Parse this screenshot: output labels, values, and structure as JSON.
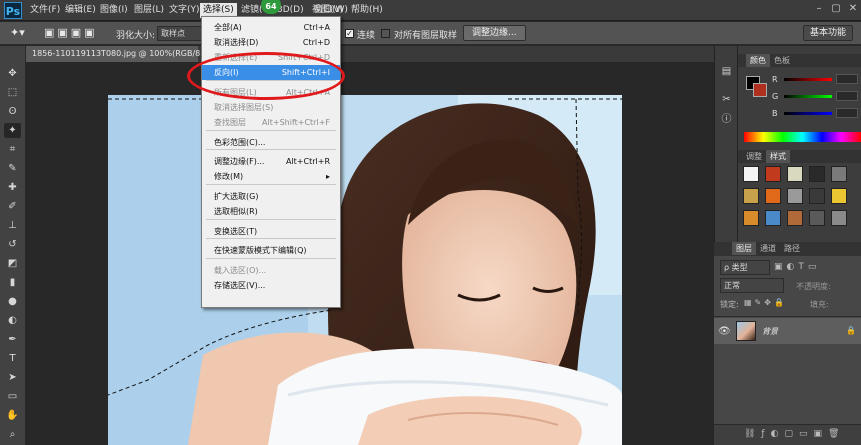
{
  "menubar": {
    "items": [
      "文件(F)",
      "编辑(E)",
      "图像(I)",
      "图层(L)",
      "文字(Y)",
      "选择(S)",
      "滤镜(T)",
      "3D(D)",
      "视图(V)",
      "窗口(W)",
      "帮助(H)"
    ],
    "badge": "64"
  },
  "options": {
    "feather_label": "羽化大小:",
    "feather_value": "取样点",
    "contiguous": "连续",
    "sample_all": "对所有图层取样",
    "refine_button": "调整边缘...",
    "workspace": "基本功能"
  },
  "document": {
    "tab_title": "1856-110119113T080.jpg @ 100%(RGB/8#)"
  },
  "select_menu": {
    "items": [
      {
        "label": "全部(A)",
        "shortcut": "Ctrl+A",
        "state": "normal"
      },
      {
        "label": "取消选择(D)",
        "shortcut": "Ctrl+D",
        "state": "normal"
      },
      {
        "label": "重新选择(E)",
        "shortcut": "Shift+Ctrl+D",
        "state": "disabled"
      },
      {
        "label": "反向(I)",
        "shortcut": "Shift+Ctrl+I",
        "state": "highlighted"
      },
      {
        "label": "所有图层(L)",
        "shortcut": "Alt+Ctrl+A",
        "state": "disabled"
      },
      {
        "label": "取消选择图层(S)",
        "shortcut": "",
        "state": "disabled"
      },
      {
        "label": "查找图层",
        "shortcut": "Alt+Shift+Ctrl+F",
        "state": "disabled"
      },
      {
        "label": "色彩范围(C)...",
        "shortcut": "",
        "state": "normal"
      },
      {
        "label": "调整边缘(F)...",
        "shortcut": "Alt+Ctrl+R",
        "state": "normal"
      },
      {
        "label": "修改(M)",
        "shortcut": "▸",
        "state": "normal"
      },
      {
        "label": "扩大选取(G)",
        "shortcut": "",
        "state": "normal"
      },
      {
        "label": "选取相似(R)",
        "shortcut": "",
        "state": "normal"
      },
      {
        "label": "变换选区(T)",
        "shortcut": "",
        "state": "normal"
      },
      {
        "label": "在快速蒙版模式下编辑(Q)",
        "shortcut": "",
        "state": "normal"
      },
      {
        "label": "载入选区(O)...",
        "shortcut": "",
        "state": "disabled"
      },
      {
        "label": "存储选区(V)...",
        "shortcut": "",
        "state": "normal"
      }
    ]
  },
  "color_panel": {
    "tabs": [
      "颜色",
      "色板"
    ],
    "channels": [
      "R",
      "G",
      "B"
    ]
  },
  "styles_panel": {
    "tabs": [
      "调整",
      "样式"
    ]
  },
  "layers_panel": {
    "tabs": [
      "图层",
      "通道",
      "路径"
    ],
    "filter": "ρ 类型",
    "blend_mode": "正常",
    "opacity_label": "不透明度:",
    "lock_label": "锁定:",
    "fill_label": "填充:",
    "layer_name": "背景"
  },
  "colors": {
    "highlight": "#3a8ee6",
    "annotation": "#e0191c"
  }
}
